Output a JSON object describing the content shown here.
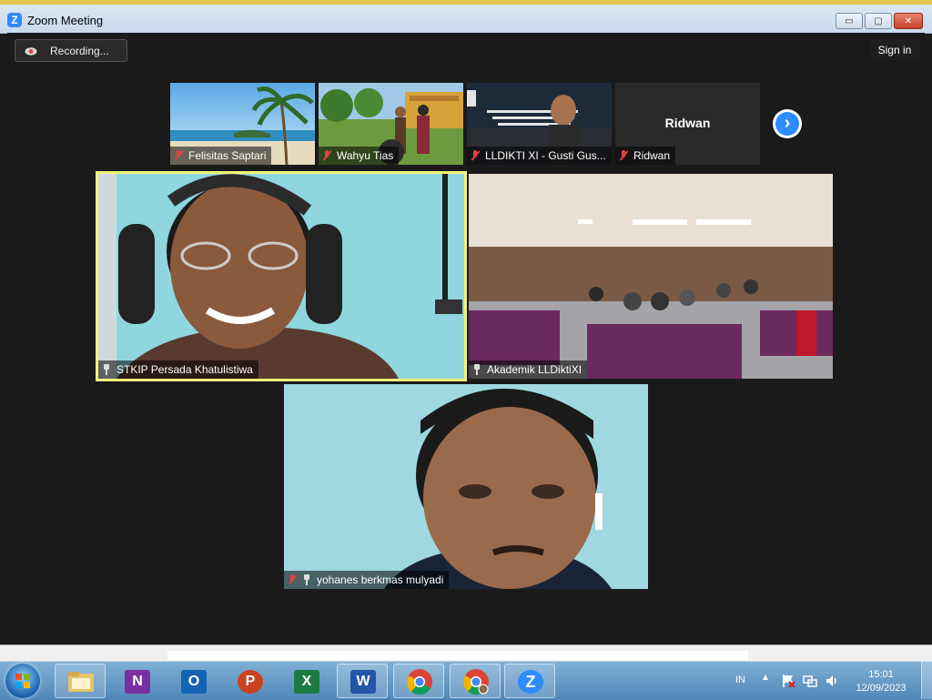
{
  "window": {
    "title": "Zoom Meeting",
    "controls": {
      "minimize": "▭",
      "maximize": "▢",
      "close": "✕"
    }
  },
  "toolbar": {
    "recording_label": "Recording...",
    "signin_label": "Sign in"
  },
  "gallery": {
    "thumbnails": [
      {
        "name": "Felisitas Saptari",
        "muted": true
      },
      {
        "name": "Wahyu Tias",
        "muted": true
      },
      {
        "name": "LLDIKTI XI - Gusti Gus...",
        "muted": true
      },
      {
        "name": "Ridwan",
        "muted": true,
        "video_off_label": "Ridwan"
      }
    ],
    "next_icon": "›"
  },
  "main_tiles": [
    {
      "name": "STKIP Persada Khatulistiwa",
      "pinned": true,
      "muted": false,
      "speaking": true
    },
    {
      "name": "Akademik LLDiktiXI",
      "pinned": true,
      "muted": false
    },
    {
      "name": "yohanes berkmas mulyadi",
      "pinned": true,
      "muted": true
    }
  ],
  "taskbar": {
    "apps": [
      {
        "name": "file-explorer-icon",
        "label": ""
      },
      {
        "name": "onenote-icon",
        "label": "N",
        "color": "#7a2fa0"
      },
      {
        "name": "outlook-icon",
        "label": "O",
        "color": "#1463b4"
      },
      {
        "name": "powerpoint-icon",
        "label": "P",
        "color": "#c9431f"
      },
      {
        "name": "excel-icon",
        "label": "X",
        "color": "#1d7a43"
      },
      {
        "name": "word-icon",
        "label": "W",
        "color": "#2356a8"
      },
      {
        "name": "chrome-icon",
        "label": ""
      },
      {
        "name": "chrome-profile-icon",
        "label": ""
      },
      {
        "name": "zoom-icon",
        "label": "Z",
        "color": "#2d8cff"
      }
    ],
    "tray": {
      "language": "IN",
      "time": "15:01",
      "date": "12/09/2023"
    }
  },
  "colors": {
    "zoom_blue": "#2d8cff",
    "speaker_border": "#f1f27a",
    "muted_red": "#e04343"
  }
}
